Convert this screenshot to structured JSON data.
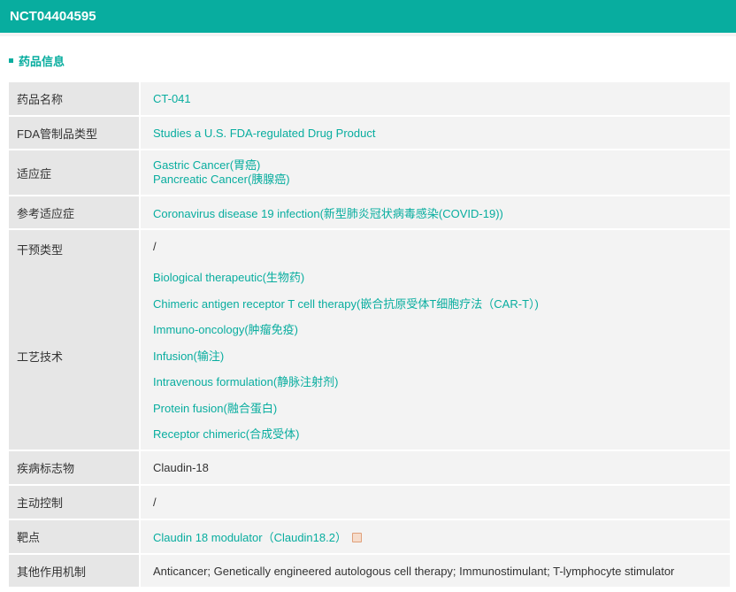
{
  "header": {
    "title": "NCT04404595"
  },
  "section": {
    "title": "药品信息"
  },
  "rows": {
    "name": {
      "label": "药品名称",
      "value": "CT-041"
    },
    "fda": {
      "label": "FDA管制品类型",
      "value": "Studies a U.S. FDA-regulated Drug Product"
    },
    "indication": {
      "label": "适应症",
      "values": [
        "Gastric Cancer(胃癌)",
        "Pancreatic Cancer(胰腺癌)"
      ]
    },
    "ref_indication": {
      "label": "参考适应症",
      "value": "Coronavirus disease 19 infection(新型肺炎冠状病毒感染(COVID-19))"
    },
    "intervention": {
      "label": "干预类型",
      "value": "/"
    },
    "technology": {
      "label": "工艺技术",
      "values": [
        "Biological therapeutic(生物药)",
        "Chimeric antigen receptor T cell therapy(嵌合抗原受体T细胞疗法（CAR-T）)",
        "Immuno-oncology(肿瘤免疫)",
        "Infusion(输注)",
        "Intravenous formulation(静脉注射剂)",
        "Protein fusion(融合蛋白)",
        "Receptor chimeric(合成受体)"
      ]
    },
    "biomarker": {
      "label": "疾病标志物",
      "value": "Claudin-18"
    },
    "active_control": {
      "label": "主动控制",
      "value": "/"
    },
    "target": {
      "label": "靶点",
      "value": "Claudin 18 modulator（Claudin18.2）"
    },
    "mechanism": {
      "label": "其他作用机制",
      "value": "Anticancer; Genetically engineered autologous cell therapy; Immunostimulant; T-lymphocyte stimulator"
    }
  }
}
